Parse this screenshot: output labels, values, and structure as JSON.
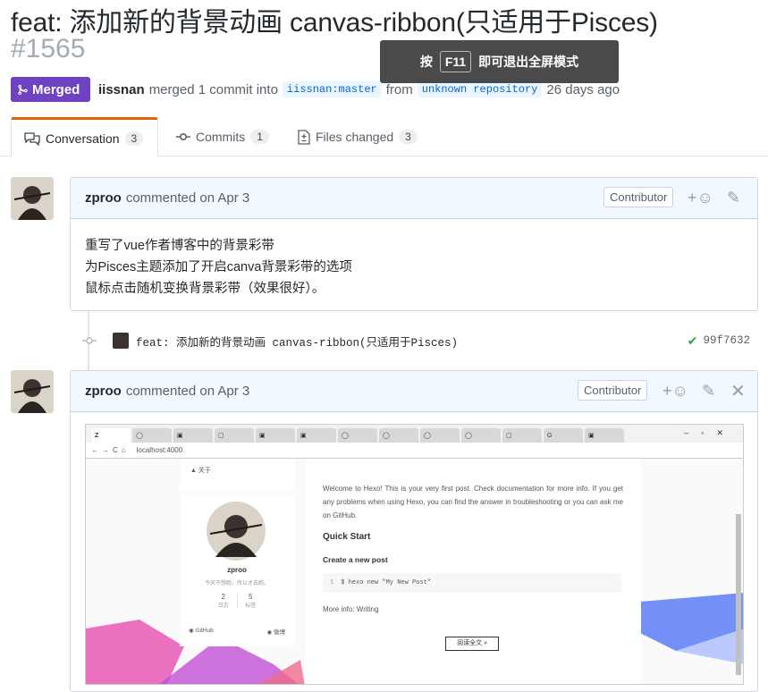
{
  "pr": {
    "title": "feat: 添加新的背景动画 canvas-ribbon(只适用于Pisces)",
    "number": "#1565",
    "state_label": "Merged",
    "author": "iissnan",
    "merge_text": "merged 1 commit into",
    "base_ref": "iissnan:master",
    "from_text": "from",
    "head_ref": "unknown repository",
    "time_ago": "26 days ago"
  },
  "fullscreen_toast": {
    "prefix": "按",
    "key": "F11",
    "suffix": "即可退出全屏模式"
  },
  "tabs": [
    {
      "label": "Conversation",
      "count": "3",
      "icon": "comment-discussion-icon"
    },
    {
      "label": "Commits",
      "count": "1",
      "icon": "git-commit-icon"
    },
    {
      "label": "Files changed",
      "count": "3",
      "icon": "file-diff-icon"
    }
  ],
  "comments": [
    {
      "author": "zproo",
      "action": "commented on Apr 3",
      "badge": "Contributor",
      "lines": [
        "重写了vue作者博客中的背景彩带",
        "为Pisces主题添加了开启canva背景彩带的选项",
        "鼠标点击随机变换背景彩带（效果很好）。"
      ]
    },
    {
      "author": "zproo",
      "action": "commented on Apr 3",
      "badge": "Contributor"
    }
  ],
  "commit": {
    "message": "feat: 添加新的背景动画 canvas-ribbon(只适用于Pisces)",
    "sha": "99f7632",
    "status_color": "#28a745"
  },
  "embedded_screenshot": {
    "url": "localhost:4000",
    "sidebar": {
      "menu_item": "关于",
      "name": "zproo",
      "motto": "今天不想跑，所以才去跑。",
      "stats": [
        {
          "value": "2",
          "label": "日志"
        },
        {
          "value": "5",
          "label": "标签"
        }
      ],
      "links": [
        "GitHub",
        "微博"
      ]
    },
    "post": {
      "intro": "Welcome to Hexo! This is your very first post. Check documentation for more info. If you get any problems when using Hexo, you can find the answer in troubleshooting or you can ask me on GitHub.",
      "h_quick_start": "Quick Start",
      "h_create_post": "Create a new post",
      "code_line_no": "1",
      "code": "$ hexo new \"My New Post\"",
      "more_info": "More info: Writing",
      "read_more": "阅读全文 »"
    }
  },
  "colors": {
    "merged": "#6f42c1",
    "toast_bg": "#3c3c3c",
    "tab_accent": "#e36209",
    "comment_header": "#f1f8ff"
  }
}
